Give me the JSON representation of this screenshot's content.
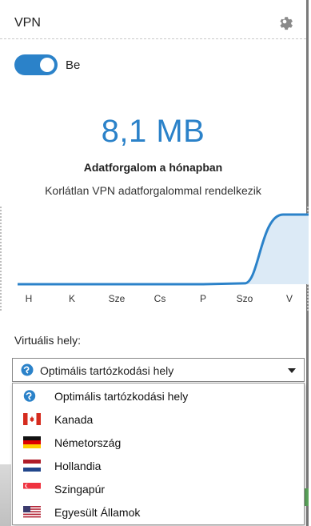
{
  "window": {
    "title": "VPN",
    "settings_icon": "gear-icon"
  },
  "toggle": {
    "state": "on",
    "label": "Be",
    "color": "#2b82c9"
  },
  "usage": {
    "value": "8,1 MB",
    "caption": "Adatforgalom a hónapban",
    "description": "Korlátlan VPN adatforgalommal rendelkezik",
    "accent": "#2b82c9"
  },
  "chart_data": {
    "type": "area",
    "categories": [
      "H",
      "K",
      "Sze",
      "Cs",
      "P",
      "Szo",
      "V"
    ],
    "values": [
      0,
      0,
      0,
      0,
      0,
      0.1,
      8.1
    ],
    "ylim": [
      0,
      8.1
    ],
    "grid": false
  },
  "location": {
    "label": "Virtuális hely:",
    "selected": "Optimális tartózkodási hely",
    "options": [
      {
        "label": "Optimális tartózkodási hely",
        "icon": "globe-icon"
      },
      {
        "label": "Kanada",
        "icon": "canada-flag-icon"
      },
      {
        "label": "Németország",
        "icon": "germany-flag-icon"
      },
      {
        "label": "Hollandia",
        "icon": "netherlands-flag-icon"
      },
      {
        "label": "Szingapúr",
        "icon": "singapore-flag-icon"
      },
      {
        "label": "Egyesült Államok",
        "icon": "usa-flag-icon"
      }
    ]
  }
}
